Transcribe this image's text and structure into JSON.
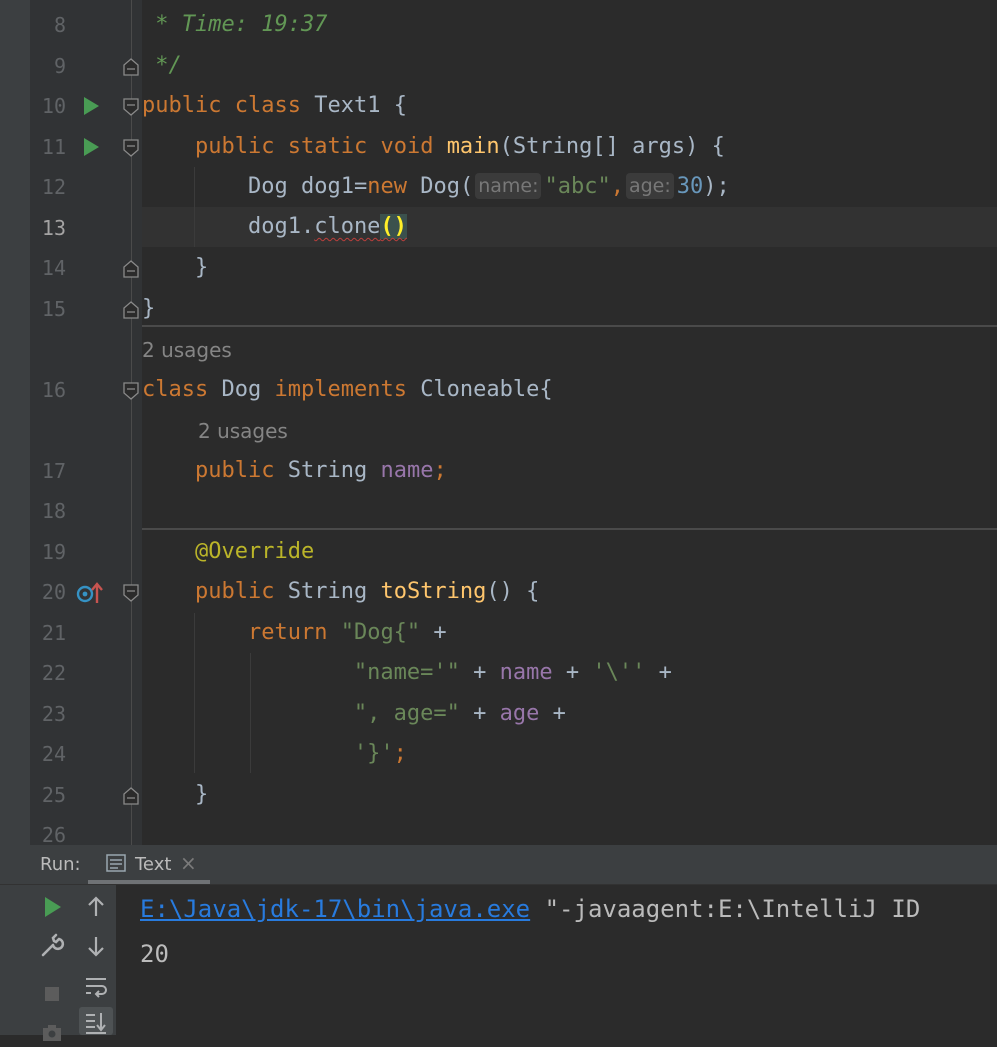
{
  "editor": {
    "line_numbers": [
      "8",
      "9",
      "10",
      "11",
      "12",
      "13",
      "14",
      "15",
      "16",
      "17",
      "18",
      "19",
      "20",
      "21",
      "22",
      "23",
      "24",
      "25",
      "26"
    ],
    "current_line": "13",
    "usages_label": "2 usages",
    "code": {
      "l8_comment": " * Time: 19:37",
      "l9_comment": " */",
      "l10": {
        "kw1": "public",
        "kw2": "class",
        "name": "Text1",
        "brace": "{"
      },
      "l11": {
        "kw1": "public",
        "kw2": "static",
        "kw3": "void",
        "fn": "main",
        "params": "(String[] args) {"
      },
      "l12": {
        "type": "Dog",
        "var": "dog1=",
        "kw": "new",
        "ctor": "Dog(",
        "hint_name": "name:",
        "str": "\"abc\"",
        "comma": ",",
        "hint_age": "age:",
        "num": "30",
        "end": ");"
      },
      "l13": {
        "obj": "dog1.",
        "method": "clone",
        "parens": "()"
      },
      "l14": "}",
      "l15": "}",
      "l16": {
        "kw1": "class",
        "name": "Dog",
        "kw2": "implements",
        "iface": "Cloneable",
        "brace": "{"
      },
      "l17": {
        "kw": "public",
        "type": "String",
        "field": "name",
        "semi": ";"
      },
      "l19": "@Override",
      "l20": {
        "kw": "public",
        "type": "String",
        "fn": "toString",
        "rest": "() {"
      },
      "l21": {
        "kw": "return",
        "str": "\"Dog{\"",
        "op": " +"
      },
      "l22": {
        "str1": "\"name='\"",
        "op1": " + ",
        "field": "name",
        "op2": " + ",
        "str2": "'\\''",
        "op3": " +"
      },
      "l23": {
        "str": "\", age=\"",
        "op1": " + ",
        "field": "age",
        "op2": " +"
      },
      "l24": {
        "str": "'}'",
        "semi": ";"
      },
      "l25": "}"
    }
  },
  "run_panel": {
    "label": "Run:",
    "tab_label": "Text",
    "tab_close": "×",
    "output_link": "E:\\Java\\jdk-17\\bin\\java.exe",
    "output_rest": " \"-javaagent:E:\\IntelliJ ID",
    "output_line2": "20",
    "tools": [
      "rerun-icon",
      "settings-wrench-icon",
      "stop-icon",
      "camera-icon",
      "scroll-up-icon",
      "scroll-down-icon",
      "soft-wrap-icon",
      "scroll-to-end-icon"
    ]
  },
  "colors": {
    "background": "#2b2b2b",
    "keyword": "#cc7832",
    "function": "#ffc66d",
    "string": "#6a8759",
    "number": "#6897bb",
    "field": "#9876aa",
    "annotation": "#bbb529",
    "comment": "#629755",
    "link": "#287bde"
  }
}
